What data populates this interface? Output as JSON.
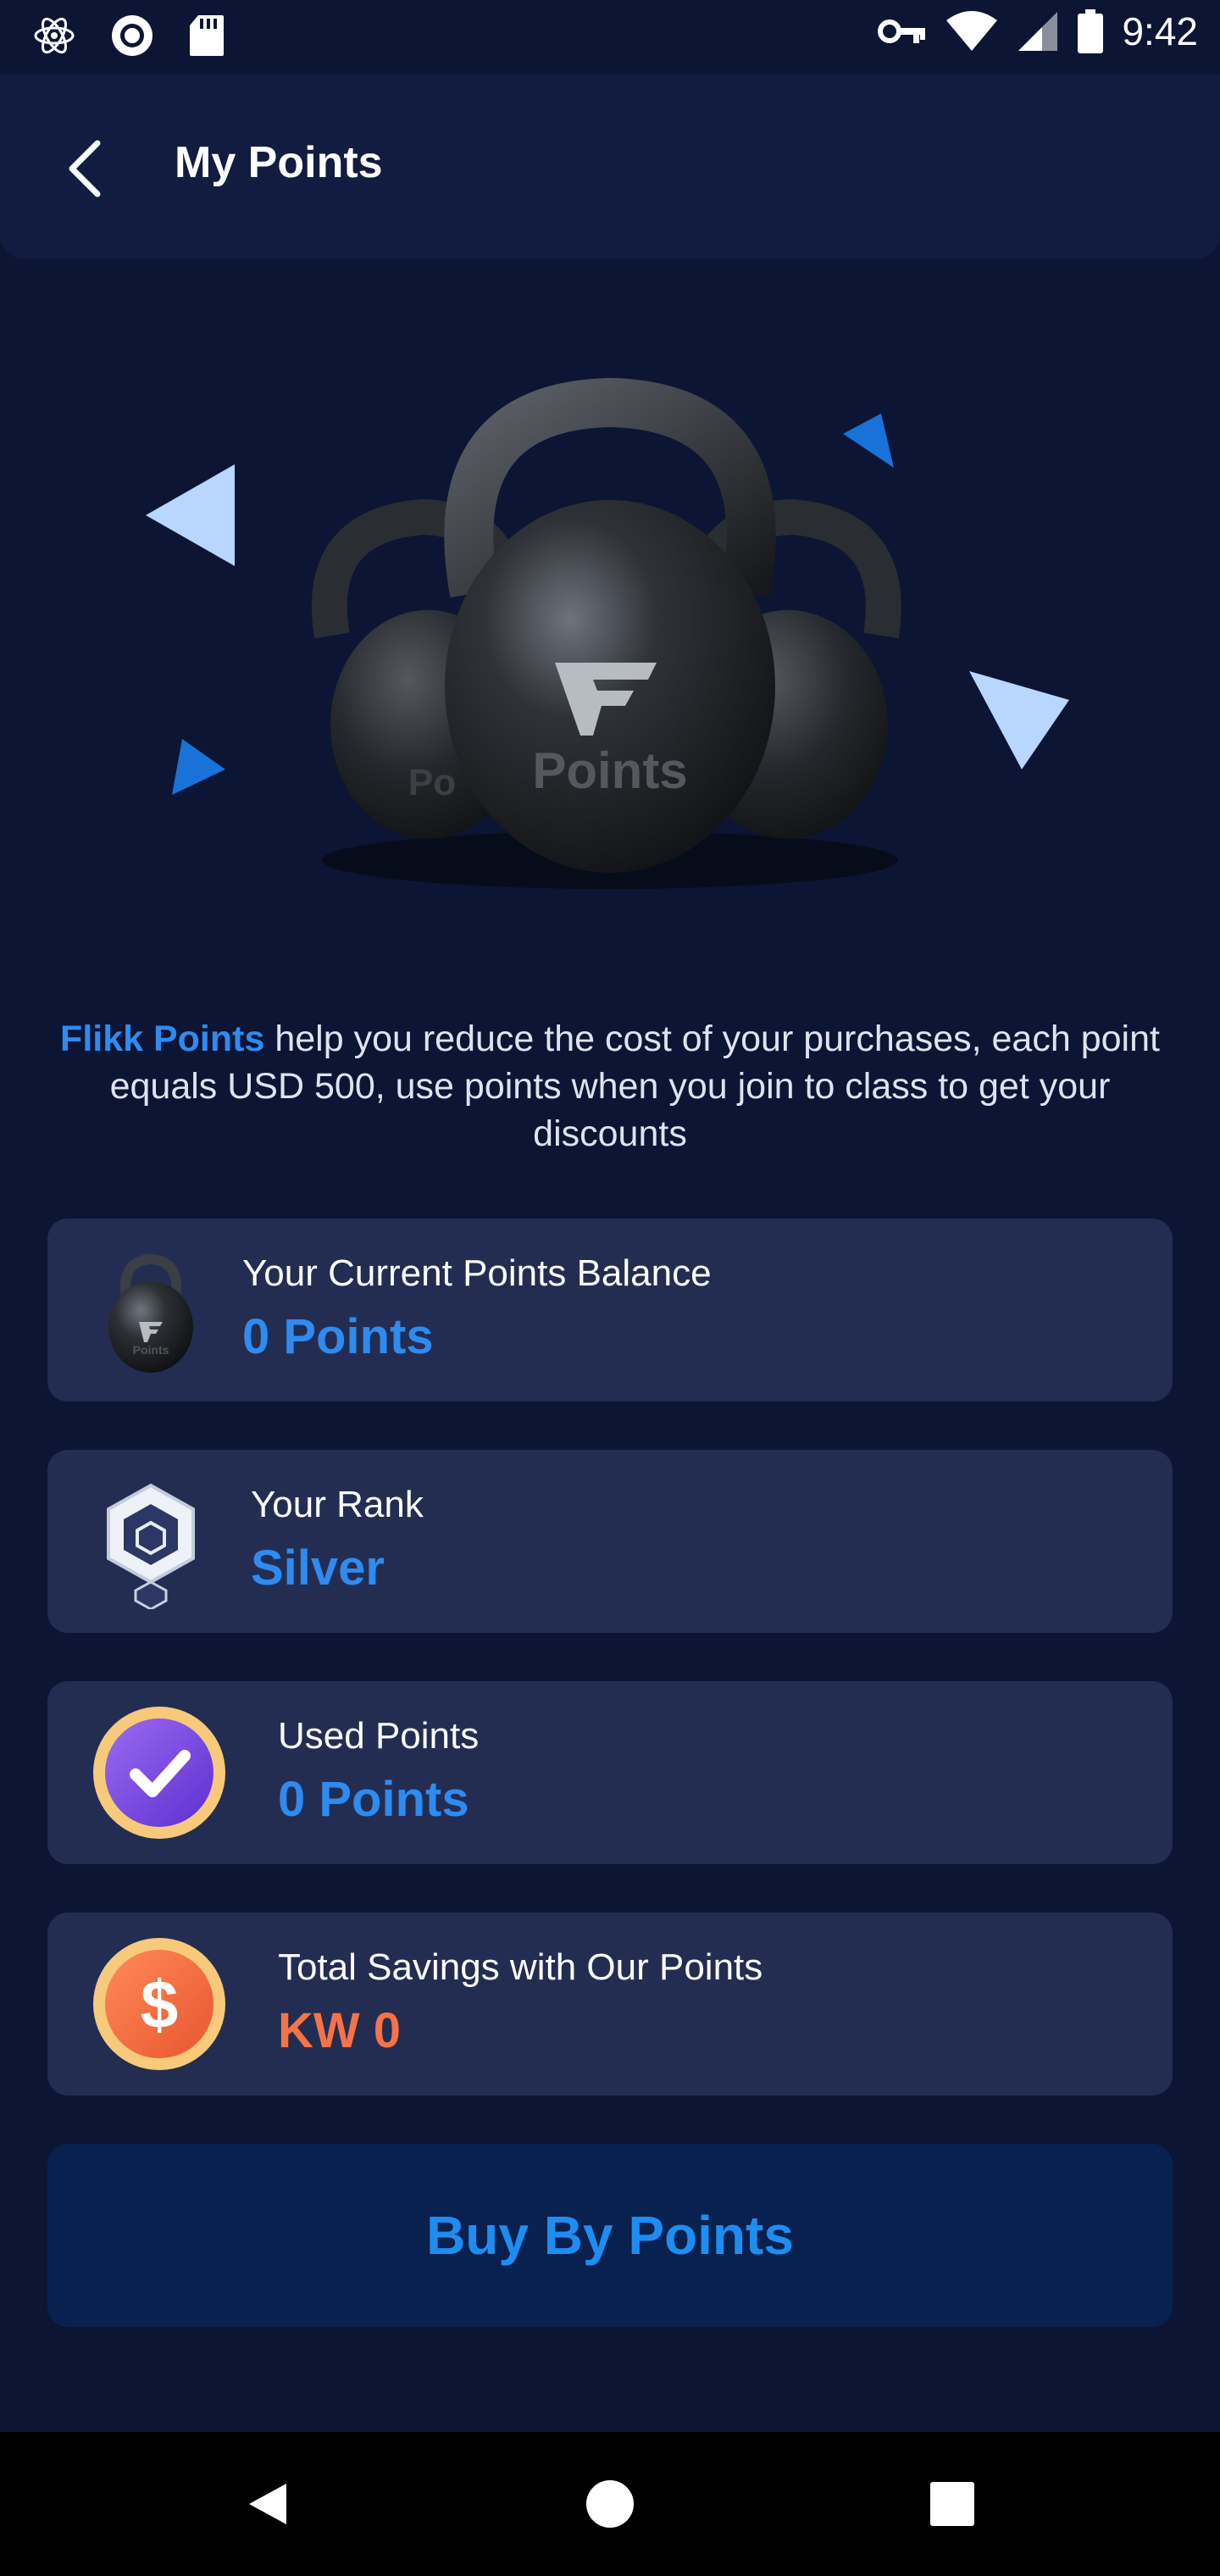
{
  "status_bar": {
    "time": "9:42",
    "left_icons": [
      "react-icon",
      "record-icon",
      "sd-card-icon"
    ],
    "right_icons": [
      "vpn-key-icon",
      "wifi-icon",
      "signal-icon",
      "battery-icon"
    ]
  },
  "header": {
    "title": "My Points"
  },
  "hero": {
    "kettlebell_label": "Points"
  },
  "description": {
    "brand": "Flikk Points",
    "text": " help you reduce the cost of your purchases, each point equals USD 500, use points when you join to class to get your discounts"
  },
  "cards": {
    "balance": {
      "label": "Your Current Points Balance",
      "value": "0 Points",
      "icon": "kettlebell-icon"
    },
    "rank": {
      "label": "Your Rank",
      "value": "Silver",
      "icon": "silver-badge-icon"
    },
    "used": {
      "label": "Used Points",
      "value": "0 Points",
      "icon": "check-badge-icon"
    },
    "savings": {
      "label": "Total Savings with Our Points",
      "value": "KW 0",
      "icon": "dollar-coin-icon"
    }
  },
  "buy_button": {
    "label": "Buy By Points"
  },
  "colors": {
    "background": "#0c1534",
    "card": "#232d52",
    "accent_blue": "#2e8bf0",
    "accent_orange": "#f57346",
    "button_bg": "#08214f"
  },
  "nav_bar": {
    "buttons": [
      "back-nav-icon",
      "home-nav-icon",
      "recents-nav-icon"
    ]
  }
}
